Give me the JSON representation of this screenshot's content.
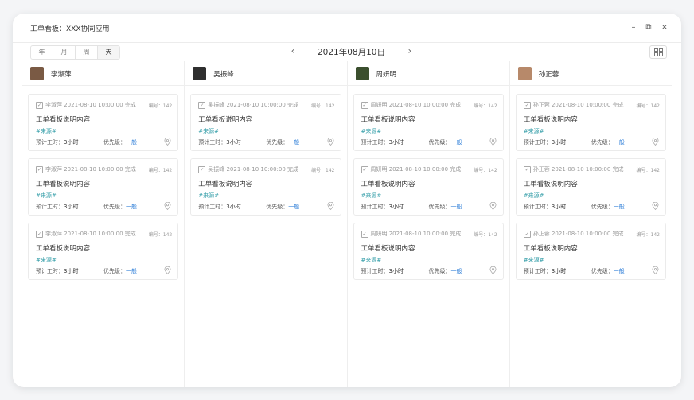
{
  "window": {
    "title": "工单看板：XXX协同应用",
    "minimize": "–",
    "restore": "⧉",
    "close": "×"
  },
  "toolbar": {
    "views": [
      "年",
      "月",
      "周",
      "天"
    ],
    "active_view": 3,
    "prev": "‹",
    "date": "2021年08月10日",
    "next": "›"
  },
  "columns": [
    {
      "user": "李淑萍",
      "avatar_color": "#7a5a44",
      "cards": 3
    },
    {
      "user": "吴振峰",
      "avatar_color": "#2f2f2f",
      "cards": 2
    },
    {
      "user": "周妍明",
      "avatar_color": "#3b4f2e",
      "cards": 3
    },
    {
      "user": "孙正蓉",
      "avatar_color": "#b7896a",
      "cards": 3
    }
  ],
  "card": {
    "meta_suffix": " 2021-08-10  10:00:00 完成",
    "number": "编号：142",
    "description": "工单看板说明内容",
    "tag": "#来源#",
    "hours_label": "预计工时：",
    "hours_value": "3小时",
    "priority_label": "优先级：",
    "priority_value": "一般"
  },
  "colors": {
    "accent": "#2f7fd8",
    "tag": "#2e9ba6"
  }
}
